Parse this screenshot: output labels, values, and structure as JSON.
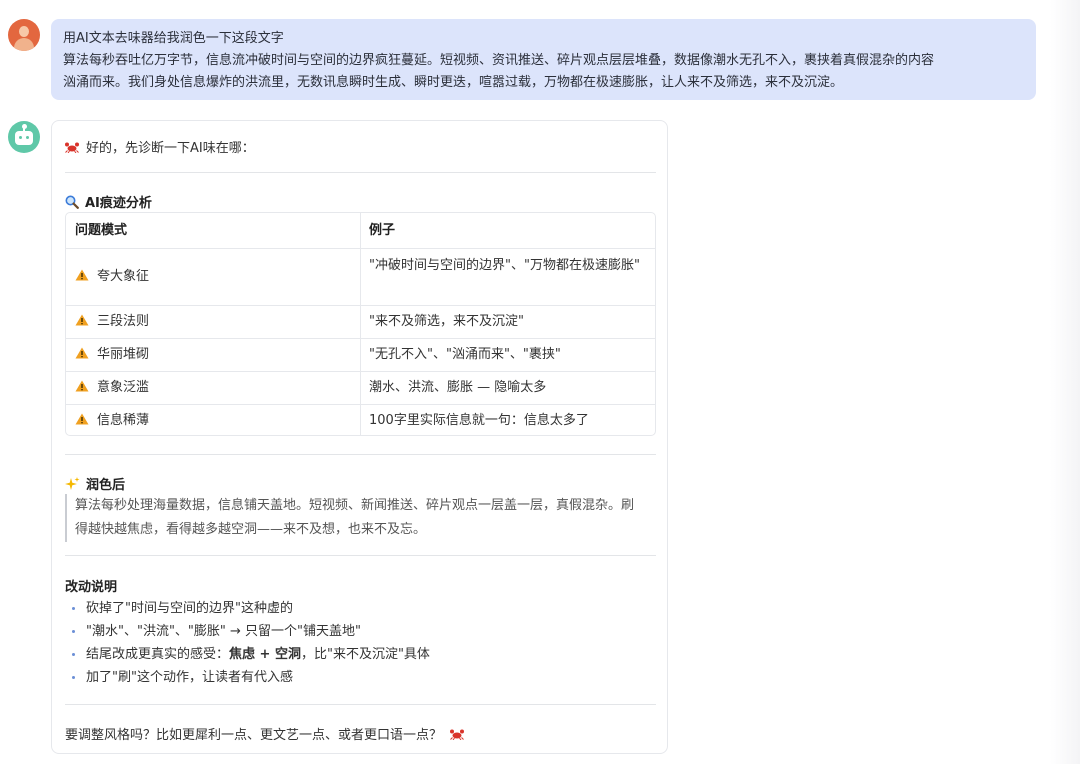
{
  "user_message": {
    "line1": "用AI文本去味器给我润色一下这段文字",
    "line2": "算法每秒吞吐亿万字节，信息流冲破时间与空间的边界疯狂蔓延。短视频、资讯推送、碎片观点层层堆叠，数据像潮水无孔不入，裹挟着真假混杂的内容",
    "line3": "汹涌而来。我们身处信息爆炸的洪流里，无数讯息瞬时生成、瞬时更迭，喧嚣过载，万物都在极速膨胀，让人来不及筛选，来不及沉淀。"
  },
  "bot_message": {
    "intro": "好的，先诊断一下AI味在哪：",
    "analysis_title": "AI痕迹分析",
    "table": {
      "headers": [
        "问题模式",
        "例子"
      ],
      "rows": [
        {
          "pattern": "夸大象征",
          "example": "\"冲破时间与空间的边界\"、\"万物都在极速膨胀\""
        },
        {
          "pattern": "三段法则",
          "example": "\"来不及筛选，来不及沉淀\""
        },
        {
          "pattern": "华丽堆砌",
          "example": "\"无孔不入\"、\"汹涌而来\"、\"裹挟\""
        },
        {
          "pattern": "意象泛滥",
          "example": "潮水、洪流、膨胀 — 隐喻太多"
        },
        {
          "pattern": "信息稀薄",
          "example": "100字里实际信息就一句：信息太多了"
        }
      ]
    },
    "polished_title": "润色后",
    "polished_text": "算法每秒处理海量数据，信息铺天盖地。短视频、新闻推送、碎片观点一层盖一层，真假混杂。刷得越快越焦虑，看得越多越空洞——来不及想，也来不及忘。",
    "changes_title": "改动说明",
    "changes": {
      "b1": "砍掉了\"时间与空间的边界\"这种虚的",
      "b2": "\"潮水\"、\"洪流\"、\"膨胀\" → 只留一个\"铺天盖地\"",
      "b3_pre": "结尾改成更真实的感受：",
      "b3_strong": "焦虑 + 空洞",
      "b3_post": "，比\"来不及沉淀\"具体",
      "b4": "加了\"刷\"这个动作，让读者有代入感"
    },
    "closing": "要调整风格吗？比如更犀利一点、更文艺一点、或者更口语一点？"
  },
  "icons": {
    "crab": "crab-icon",
    "magnifier": "magnifier-icon",
    "sparkles": "sparkles-icon",
    "warning": "warning-icon"
  },
  "colors": {
    "user_bubble": "#dce4fb",
    "bot_avatar": "#5fc8a8",
    "user_avatar": "#e3673f",
    "crab": "#d9342b",
    "warning": "#f0a020",
    "bullet": "#6b8fd6"
  }
}
